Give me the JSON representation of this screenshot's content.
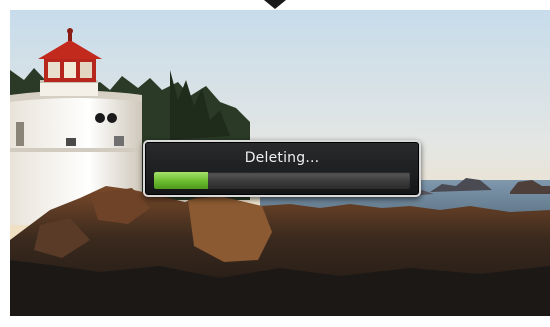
{
  "dialog": {
    "label": "Deleting...",
    "progress": 0.21
  },
  "colors": {
    "progress_green": "#6fbe33",
    "dialog_background": "#1e1f21",
    "dialog_border": "#d9d9d9"
  },
  "icons": {
    "top_indicator": "chevron-down-icon"
  }
}
